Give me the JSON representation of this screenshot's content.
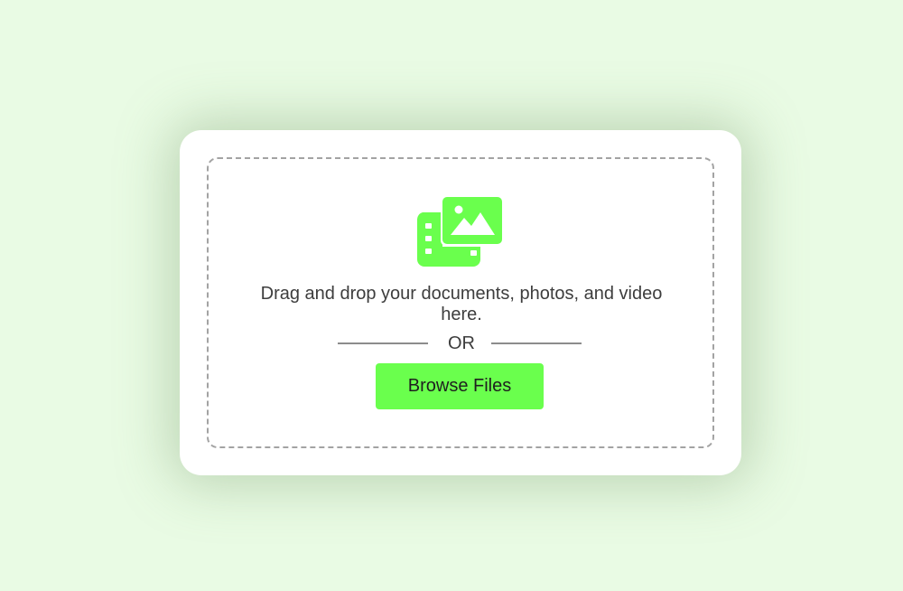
{
  "upload": {
    "instruction_text": "Drag and drop your documents, photos, and video here.",
    "or_text": "OR",
    "browse_label": "Browse Files",
    "icon": "photo-film-icon"
  },
  "colors": {
    "background": "#e9fbe4",
    "card": "#ffffff",
    "accent": "#6aff4d",
    "dashed_border": "#a3a3a3",
    "text": "#3d3d3d"
  }
}
